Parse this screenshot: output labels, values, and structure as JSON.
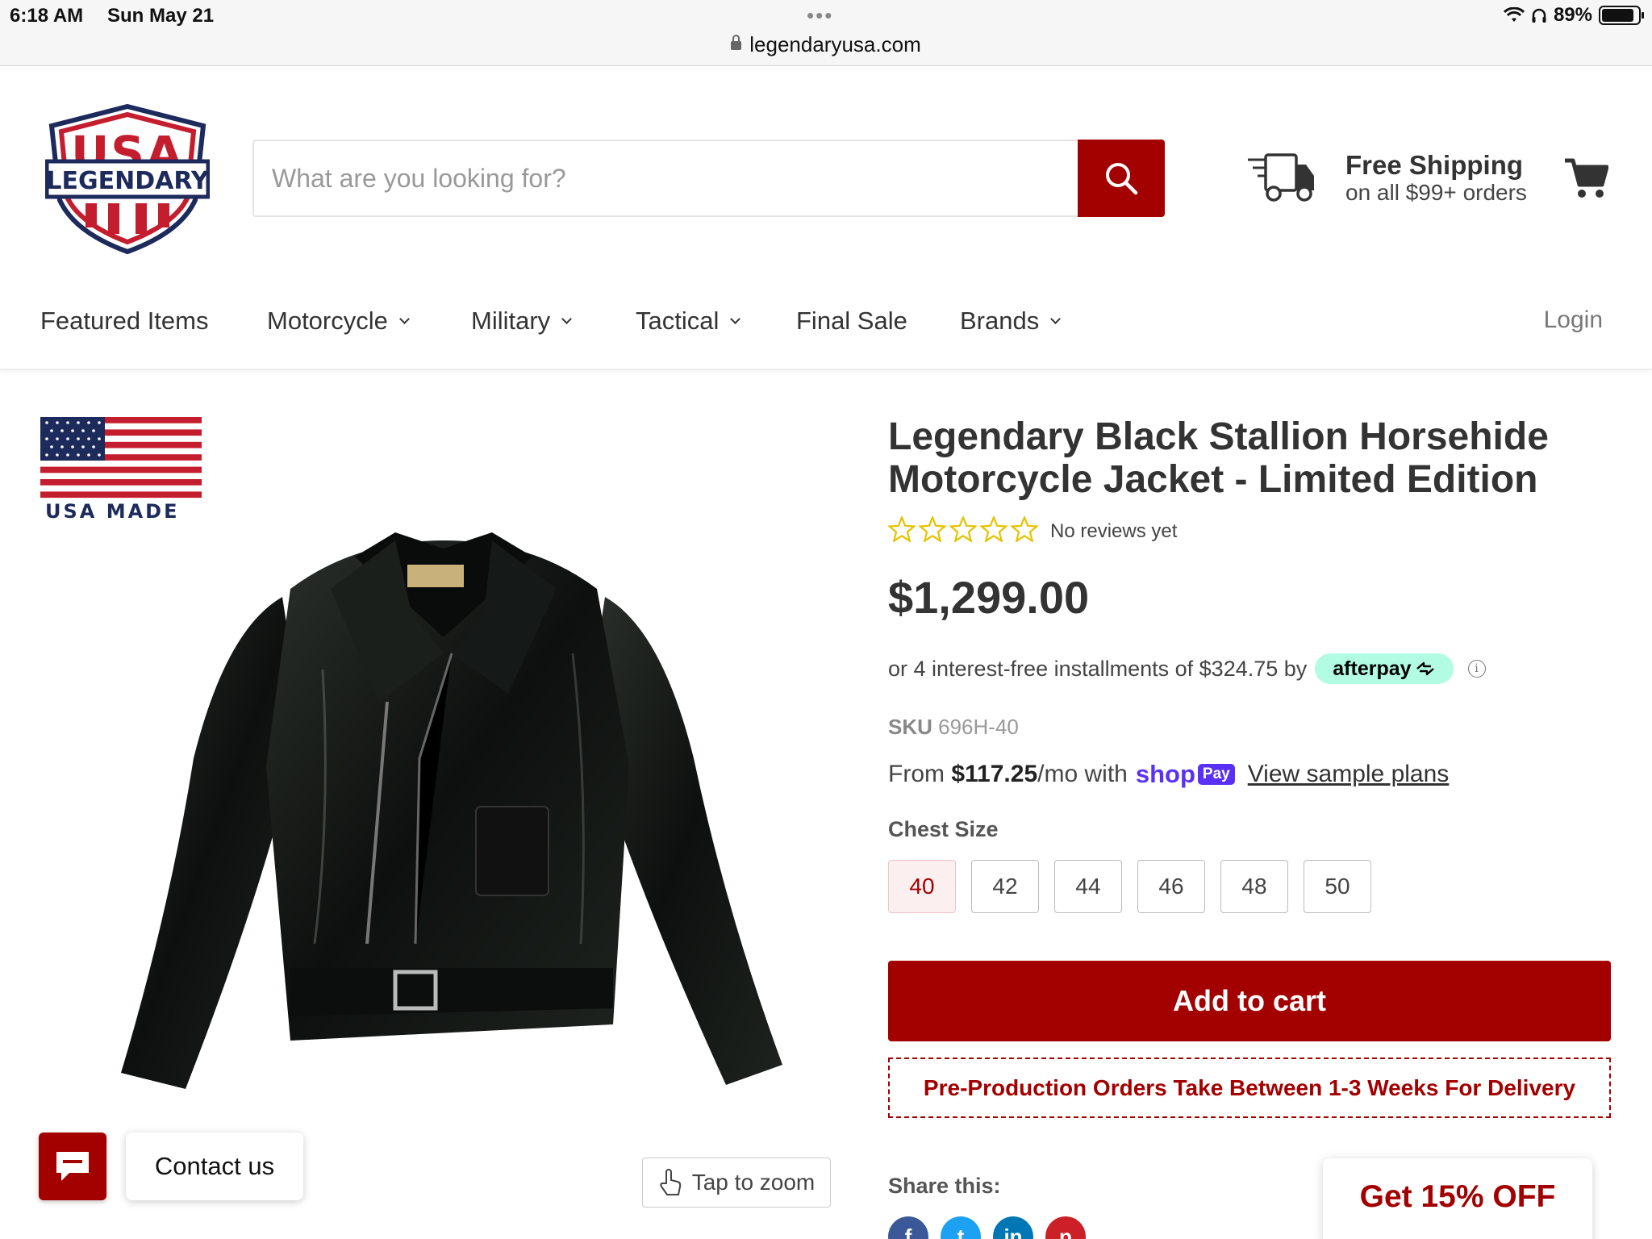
{
  "status_bar": {
    "time": "6:18 AM",
    "date": "Sun May 21",
    "battery": "89%",
    "battery_level": 0.89,
    "url": "legendaryusa.com"
  },
  "header": {
    "logo_top": "USA",
    "logo_text": "LEGENDARY",
    "search_placeholder": "What are you looking for?",
    "shipping_title": "Free Shipping",
    "shipping_subtitle": "on all $99+ orders"
  },
  "nav": {
    "items": [
      {
        "label": "Featured Items",
        "dropdown": false
      },
      {
        "label": "Motorcycle",
        "dropdown": true
      },
      {
        "label": "Military",
        "dropdown": true
      },
      {
        "label": "Tactical",
        "dropdown": true
      },
      {
        "label": "Final Sale",
        "dropdown": false
      },
      {
        "label": "Brands",
        "dropdown": true
      }
    ],
    "login": "Login"
  },
  "gallery": {
    "badge_text": "USA MADE",
    "zoom_label": "Tap to zoom"
  },
  "chat": {
    "contact_label": "Contact us"
  },
  "product": {
    "title": "Legendary Black Stallion Horsehide Motorcycle Jacket - Limited Edition",
    "rating": 0,
    "reviews_text": "No reviews yet",
    "price": "$1,299.00",
    "installments_text": "or 4 interest-free installments of $324.75 by",
    "afterpay_label": "afterpay",
    "sku_label": "SKU",
    "sku_value": "696H-40",
    "shoppay_from": "From",
    "shoppay_amount": "$117.25",
    "shoppay_suffix": "/mo with",
    "shoppay_brand": "shop",
    "shoppay_pay": "Pay",
    "shoppay_link": "View sample plans",
    "size_label": "Chest Size",
    "sizes": [
      "40",
      "42",
      "44",
      "46",
      "48",
      "50"
    ],
    "selected_size": "40",
    "add_to_cart": "Add to cart",
    "preproduction_note": "Pre-Production Orders Take Between 1-3 Weeks For Delivery",
    "share_label": "Share this:"
  },
  "promo": {
    "discount_label": "Get 15% OFF"
  },
  "colors": {
    "brand_red": "#a30000",
    "afterpay_mint": "#b2fce4",
    "shoppay_purple": "#5a31f4",
    "star_outline": "#e6c200"
  }
}
